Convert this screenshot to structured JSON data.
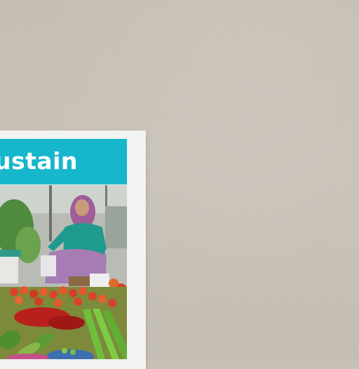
{
  "poster": {
    "banner_text": "ustain"
  },
  "colors": {
    "wall": "#c9c1b5",
    "poster_border": "#f1f2f1",
    "banner": "#16b7cc"
  },
  "photo_subject": "market-vendor-woman-with-vegetables"
}
